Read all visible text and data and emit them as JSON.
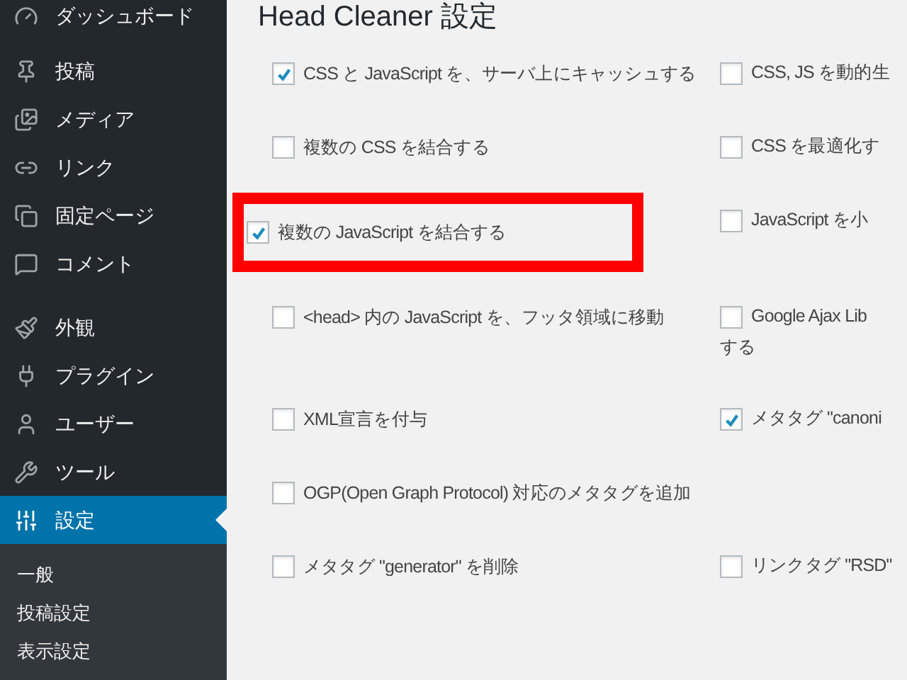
{
  "sidebar": {
    "groups": [
      [
        {
          "label": "ダッシュボード",
          "selected": false
        }
      ],
      [
        {
          "label": "投稿",
          "selected": false
        },
        {
          "label": "メディア",
          "selected": false
        },
        {
          "label": "リンク",
          "selected": false
        },
        {
          "label": "固定ページ",
          "selected": false
        },
        {
          "label": "コメント",
          "selected": false
        }
      ],
      [
        {
          "label": "外観",
          "selected": false
        },
        {
          "label": "プラグイン",
          "selected": false
        },
        {
          "label": "ユーザー",
          "selected": false
        },
        {
          "label": "ツール",
          "selected": false
        },
        {
          "label": "設定",
          "selected": true
        }
      ]
    ],
    "submenu": [
      "一般",
      "投稿設定",
      "表示設定"
    ]
  },
  "page": {
    "title": "Head Cleaner 設定",
    "rows": [
      {
        "left": {
          "label": "CSS と JavaScript を、サーバ上にキャッシュする",
          "checked": true,
          "highlighted": false
        },
        "right": {
          "label": "CSS, JS を動的生",
          "checked": false
        }
      },
      {
        "left": {
          "label": "複数の CSS を結合する",
          "checked": false,
          "highlighted": false
        },
        "right": {
          "label": "CSS を最適化す",
          "checked": false
        }
      },
      {
        "left": {
          "label": "複数の JavaScript を結合する",
          "checked": true,
          "highlighted": true
        },
        "right": {
          "label": "JavaScript を小",
          "checked": false
        }
      },
      {
        "left": {
          "label": "<head> 内の JavaScript を、フッタ領域に移動",
          "checked": false,
          "highlighted": false
        },
        "right": {
          "label": "Google Ajax Lib",
          "label_line2": "する",
          "checked": false
        }
      },
      {
        "left": {
          "label": "XML宣言を付与",
          "checked": false,
          "highlighted": false
        },
        "right": {
          "label": "メタタグ \"canoni",
          "checked": true
        }
      },
      {
        "left": {
          "label": "OGP(Open Graph Protocol) 対応のメタタグを追加",
          "checked": false,
          "highlighted": false
        }
      },
      {
        "left": {
          "label": "メタタグ \"generator\" を削除",
          "checked": false,
          "highlighted": false
        },
        "right": {
          "label": "リンクタグ \"RSD\"",
          "checked": false
        }
      }
    ]
  }
}
